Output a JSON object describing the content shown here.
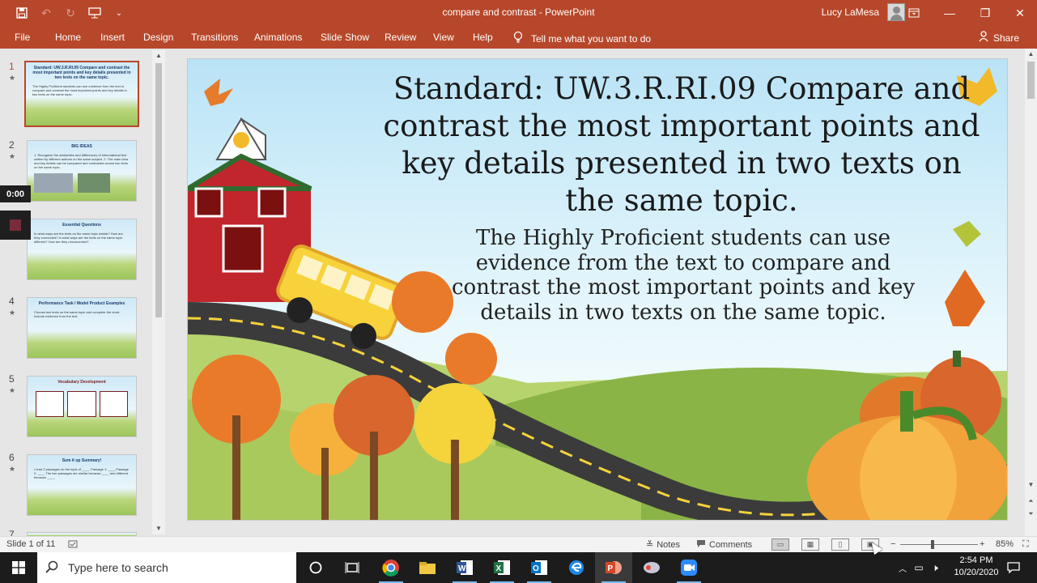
{
  "window": {
    "title": "compare and contrast  -  PowerPoint",
    "user": "Lucy LaMesa",
    "qat_icons": [
      "save-icon",
      "undo-icon",
      "redo-icon",
      "present-from-start-icon",
      "customize-qat-icon"
    ]
  },
  "ribbon": {
    "tabs": [
      "File",
      "Home",
      "Insert",
      "Design",
      "Transitions",
      "Animations",
      "Slide Show",
      "Review",
      "View",
      "Help"
    ],
    "tell_me": "Tell me what you want to do",
    "share": "Share"
  },
  "thumbnails": [
    {
      "number": "1",
      "star": "★",
      "title": "Standard: UW.3.R.RI.09 Compare and contrast the most important points and key details presented in two texts on the same topic.",
      "text": "The Highly Proficient students can use evidence from the text to compare and contrast the most important points and key details in two texts on the same topic."
    },
    {
      "number": "2",
      "star": "★",
      "title": "BIG IDEAS",
      "text": "1. Recognize the similarities and differences of informational text written by different authors on the same subject. 2. The main idea and key details can be compared and contrasted across two texts on the same topic."
    },
    {
      "number": "3",
      "star": "",
      "title": "Essential Questions",
      "text": "In what ways are the texts on the same topic similar? How are they connected? In what ways are the texts on the same topic different? How are they unconnected?"
    },
    {
      "number": "4",
      "star": "★",
      "title": "Performance Task / Model Product Examples",
      "text": "Choose two texts on the same topic and complete the chart. Include evidence from the text."
    },
    {
      "number": "5",
      "star": "★",
      "title": "Vocabulary Development",
      "text": ""
    },
    {
      "number": "6",
      "star": "★",
      "title": "Sum it up Summary!",
      "text": "I read 2 passages on the topic of ____. Passage 1: ____ Passage 2: ____ The two passages are similar because ____ and different because ____."
    },
    {
      "number": "7",
      "star": "",
      "title": "",
      "text": ""
    }
  ],
  "recording": {
    "time": "0:00"
  },
  "slide": {
    "title": "Standard: UW.3.R.RI.09 Compare and contrast the most important points and key details presented in two texts on the same topic.",
    "body": "The Highly Proficient students can use evidence from the text to compare and contrast the most important points and key details in two texts on the same topic."
  },
  "statusbar": {
    "slide_counter": "Slide 1 of 11",
    "notes": "Notes",
    "comments": "Comments",
    "zoom": "85%"
  },
  "taskbar": {
    "search_placeholder": "Type here to search",
    "apps": [
      "cortana-icon",
      "task-view-icon",
      "chrome-icon",
      "file-explorer-icon",
      "word-icon",
      "excel-icon",
      "outlook-icon",
      "edge-icon",
      "powerpoint-icon",
      "snipping-icon",
      "zoom-icon"
    ],
    "time": "2:54 PM",
    "date": "10/20/2020"
  },
  "colors": {
    "accent": "#b7472a",
    "taskbar": "#1c1c1c"
  }
}
